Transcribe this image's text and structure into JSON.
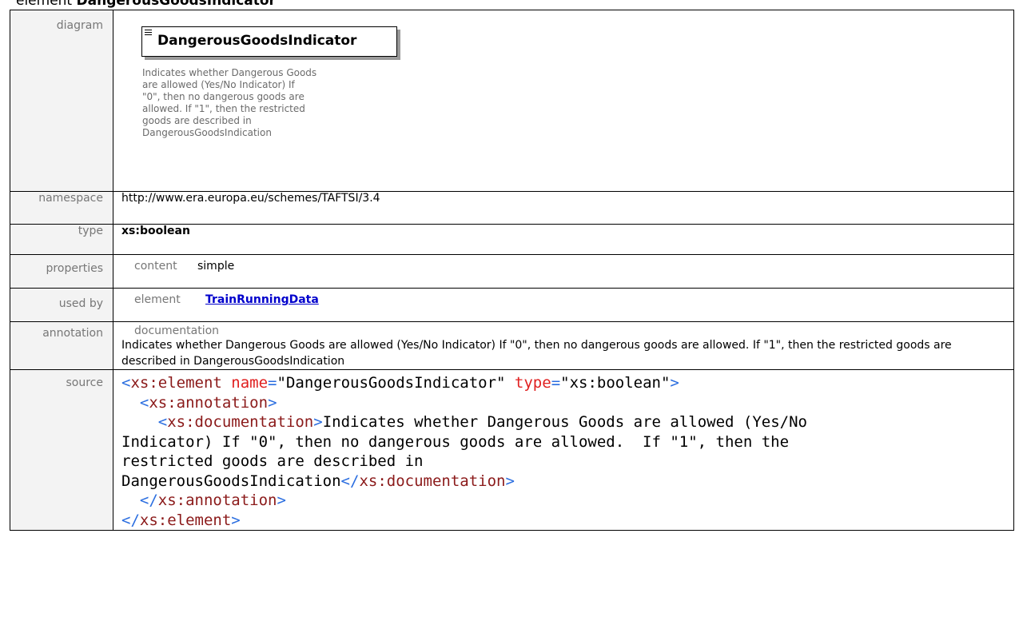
{
  "heading": {
    "prefix": "element",
    "name": "DangerousGoodsIndicator"
  },
  "rows": {
    "diagram": {
      "label": "diagram",
      "element_name": "DangerousGoodsIndicator",
      "doc_lines": [
        "Indicates whether Dangerous Goods",
        "are allowed (Yes/No Indicator) If",
        "\"0\", then no dangerous goods are",
        "allowed.  If \"1\", then the restricted",
        "goods are described in",
        "DangerousGoodsIndication"
      ]
    },
    "namespace": {
      "label": "namespace",
      "value": "http://www.era.europa.eu/schemes/TAFTSI/3.4"
    },
    "type": {
      "label": "type",
      "value": "xs:boolean"
    },
    "properties": {
      "label": "properties",
      "key": "content",
      "value": "simple"
    },
    "used_by": {
      "label": "used by",
      "key": "element",
      "link": "TrainRunningData"
    },
    "annotation": {
      "label": "annotation",
      "key": "documentation",
      "text": "Indicates whether Dangerous Goods are allowed (Yes/No Indicator) If \"0\", then no dangerous goods are allowed.  If \"1\", then the restricted goods are described in DangerousGoodsIndication"
    },
    "source": {
      "label": "source",
      "line1_open": "<",
      "line1_tag": "xs:element",
      "line1_attr1": " name",
      "line1_eq1": "=",
      "line1_val1": "\"DangerousGoodsIndicator\"",
      "line1_attr2": " type",
      "line1_eq2": "=",
      "line1_val2": "\"xs:boolean\"",
      "line1_close": ">",
      "line2_indent": "  ",
      "line2_open": "<",
      "line2_tag": "xs:annotation",
      "line2_close": ">",
      "line3_indent": "    ",
      "line3_open": "<",
      "line3_tag": "xs:documentation",
      "line3_close": ">",
      "doc_text_1": "Indicates whether Dangerous Goods are allowed (Yes/No",
      "doc_text_2": "Indicator) If \"0\", then no dangerous goods are allowed.  If \"1\", then the",
      "doc_text_3": "restricted goods are described in",
      "doc_text_4": "DangerousGoodsIndication",
      "line6_open": "</",
      "line6_tag": "xs:documentation",
      "line6_close": ">",
      "line7_indent": "  ",
      "line7_open": "</",
      "line7_tag": "xs:annotation",
      "line7_close": ">",
      "line8_open": "</",
      "line8_tag": "xs:element",
      "line8_close": ">"
    }
  },
  "colors": {
    "link": "#0000cc",
    "label_text": "#777777",
    "xml_bracket": "#2b6ee0",
    "xml_tag": "#8b1a1a",
    "xml_attr": "#e02020",
    "xml_value": "#1a1a8b"
  }
}
